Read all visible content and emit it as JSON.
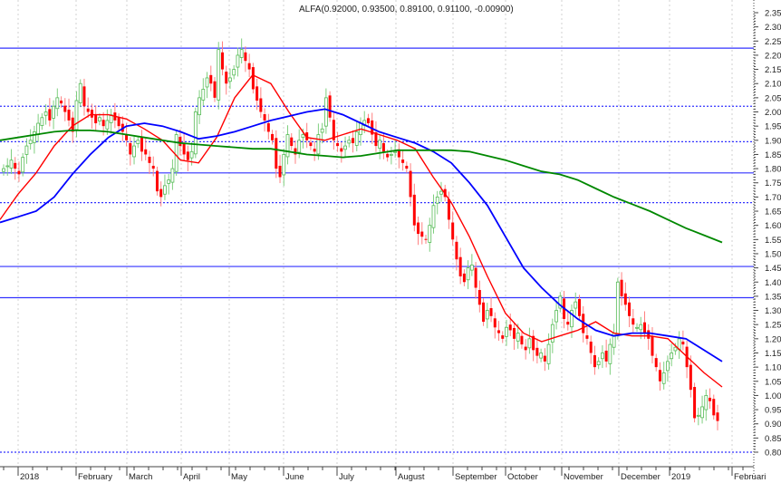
{
  "chart_data": {
    "type": "candlestick",
    "title": "ALFA(0.92000, 0.93500, 0.89100, 0.91100, -0.00900)",
    "ylim": [
      0.8,
      2.35
    ],
    "y_ticks": [
      "2.35",
      "2.30",
      "2.25",
      "2.20",
      "2.15",
      "2.10",
      "2.05",
      "2.00",
      "1.95",
      "1.90",
      "1.85",
      "1.80",
      "1.75",
      "1.70",
      "1.65",
      "1.60",
      "1.55",
      "1.50",
      "1.45",
      "1.40",
      "1.35",
      "1.30",
      "1.25",
      "1.20",
      "1.15",
      "1.10",
      "1.05",
      "1.00",
      "0.95",
      "0.90",
      "0.85",
      "0.80"
    ],
    "x_ticks": [
      "2018",
      "February",
      "March",
      "April",
      "May",
      "June",
      "July",
      "August",
      "September",
      "October",
      "November",
      "December",
      "2019",
      "Februari"
    ],
    "closes": [
      1.8,
      1.81,
      1.83,
      1.8,
      1.78,
      1.84,
      1.88,
      1.9,
      1.93,
      1.96,
      1.98,
      2.0,
      1.97,
      2.02,
      2.05,
      2.03,
      2.0,
      1.97,
      1.93,
      2.04,
      2.1,
      2.02,
      2.0,
      1.98,
      1.96,
      1.98,
      1.95,
      1.97,
      1.99,
      1.97,
      1.95,
      1.93,
      1.9,
      1.85,
      1.88,
      1.9,
      1.86,
      1.85,
      1.82,
      1.8,
      1.72,
      1.7,
      1.74,
      1.76,
      1.8,
      1.92,
      1.88,
      1.85,
      1.83,
      1.86,
      2.0,
      2.05,
      2.08,
      2.12,
      2.1,
      2.05,
      2.22,
      2.15,
      2.1,
      2.12,
      2.15,
      2.2,
      2.22,
      2.18,
      2.15,
      2.08,
      2.04,
      2.0,
      1.97,
      1.93,
      1.9,
      1.8,
      1.77,
      1.85,
      1.92,
      1.88,
      1.85,
      1.9,
      1.92,
      1.9,
      1.88,
      1.86,
      1.92,
      1.94,
      2.05,
      1.98,
      1.9,
      1.88,
      1.86,
      1.88,
      1.9,
      1.89,
      1.93,
      1.96,
      1.97,
      1.96,
      1.92,
      1.88,
      1.9,
      1.86,
      1.84,
      1.85,
      1.86,
      1.84,
      1.82,
      1.8,
      1.7,
      1.6,
      1.57,
      1.56,
      1.55,
      1.6,
      1.67,
      1.7,
      1.72,
      1.7,
      1.62,
      1.55,
      1.48,
      1.42,
      1.4,
      1.45,
      1.46,
      1.38,
      1.32,
      1.26,
      1.3,
      1.28,
      1.24,
      1.22,
      1.2,
      1.24,
      1.23,
      1.2,
      1.22,
      1.18,
      1.16,
      1.2,
      1.16,
      1.14,
      1.15,
      1.12,
      1.18,
      1.25,
      1.3,
      1.35,
      1.27,
      1.25,
      1.3,
      1.33,
      1.28,
      1.22,
      1.2,
      1.15,
      1.1,
      1.12,
      1.15,
      1.12,
      1.18,
      1.22,
      1.4,
      1.35,
      1.32,
      1.28,
      1.25,
      1.24,
      1.25,
      1.22,
      1.2,
      1.14,
      1.1,
      1.05,
      1.08,
      1.12,
      1.15,
      1.17,
      1.2,
      1.18,
      1.1,
      1.02,
      0.92,
      0.93,
      0.96,
      1.0,
      0.98,
      0.93,
      0.91
    ],
    "moving_averages": [
      {
        "name": "short MA",
        "color": "#ff0000",
        "values": [
          1.62,
          1.71,
          1.785,
          1.88,
          1.95,
          1.99,
          1.99,
          1.975,
          1.94,
          1.9,
          1.83,
          1.82,
          1.91,
          2.05,
          2.13,
          2.1,
          2.0,
          1.91,
          1.9,
          1.92,
          1.94,
          1.92,
          1.9,
          1.87,
          1.77,
          1.68,
          1.56,
          1.42,
          1.29,
          1.22,
          1.19,
          1.21,
          1.23,
          1.26,
          1.22,
          1.21,
          1.21,
          1.2,
          1.14,
          1.08,
          1.03
        ]
      },
      {
        "name": "medium MA",
        "color": "#0000ff",
        "values": [
          1.61,
          1.63,
          1.65,
          1.7,
          1.78,
          1.85,
          1.91,
          1.95,
          1.96,
          1.95,
          1.93,
          1.905,
          1.915,
          1.93,
          1.95,
          1.97,
          1.985,
          2.0,
          2.01,
          1.99,
          1.96,
          1.93,
          1.91,
          1.89,
          1.86,
          1.82,
          1.75,
          1.67,
          1.56,
          1.45,
          1.38,
          1.32,
          1.27,
          1.23,
          1.21,
          1.22,
          1.22,
          1.21,
          1.2,
          1.16,
          1.12
        ]
      },
      {
        "name": "long MA",
        "color": "#008800",
        "values": [
          1.9,
          1.91,
          1.92,
          1.93,
          1.935,
          1.935,
          1.93,
          1.92,
          1.91,
          1.9,
          1.89,
          1.885,
          1.88,
          1.875,
          1.87,
          1.87,
          1.86,
          1.85,
          1.845,
          1.84,
          1.845,
          1.855,
          1.865,
          1.865,
          1.865,
          1.865,
          1.86,
          1.845,
          1.83,
          1.81,
          1.79,
          1.78,
          1.76,
          1.73,
          1.7,
          1.675,
          1.65,
          1.62,
          1.59,
          1.565,
          1.54
        ]
      }
    ],
    "horizontal_lines": [
      {
        "price": 2.225,
        "style": "solid"
      },
      {
        "price": 2.02,
        "style": "dotted"
      },
      {
        "price": 1.895,
        "style": "dotted"
      },
      {
        "price": 1.785,
        "style": "solid"
      },
      {
        "price": 1.68,
        "style": "dotted"
      },
      {
        "price": 1.455,
        "style": "solid"
      },
      {
        "price": 1.345,
        "style": "solid"
      },
      {
        "price": 0.8,
        "style": "dotted"
      }
    ],
    "colors": {
      "up": "#22aa22",
      "down": "#ff0000",
      "level": "#3333ff"
    }
  }
}
